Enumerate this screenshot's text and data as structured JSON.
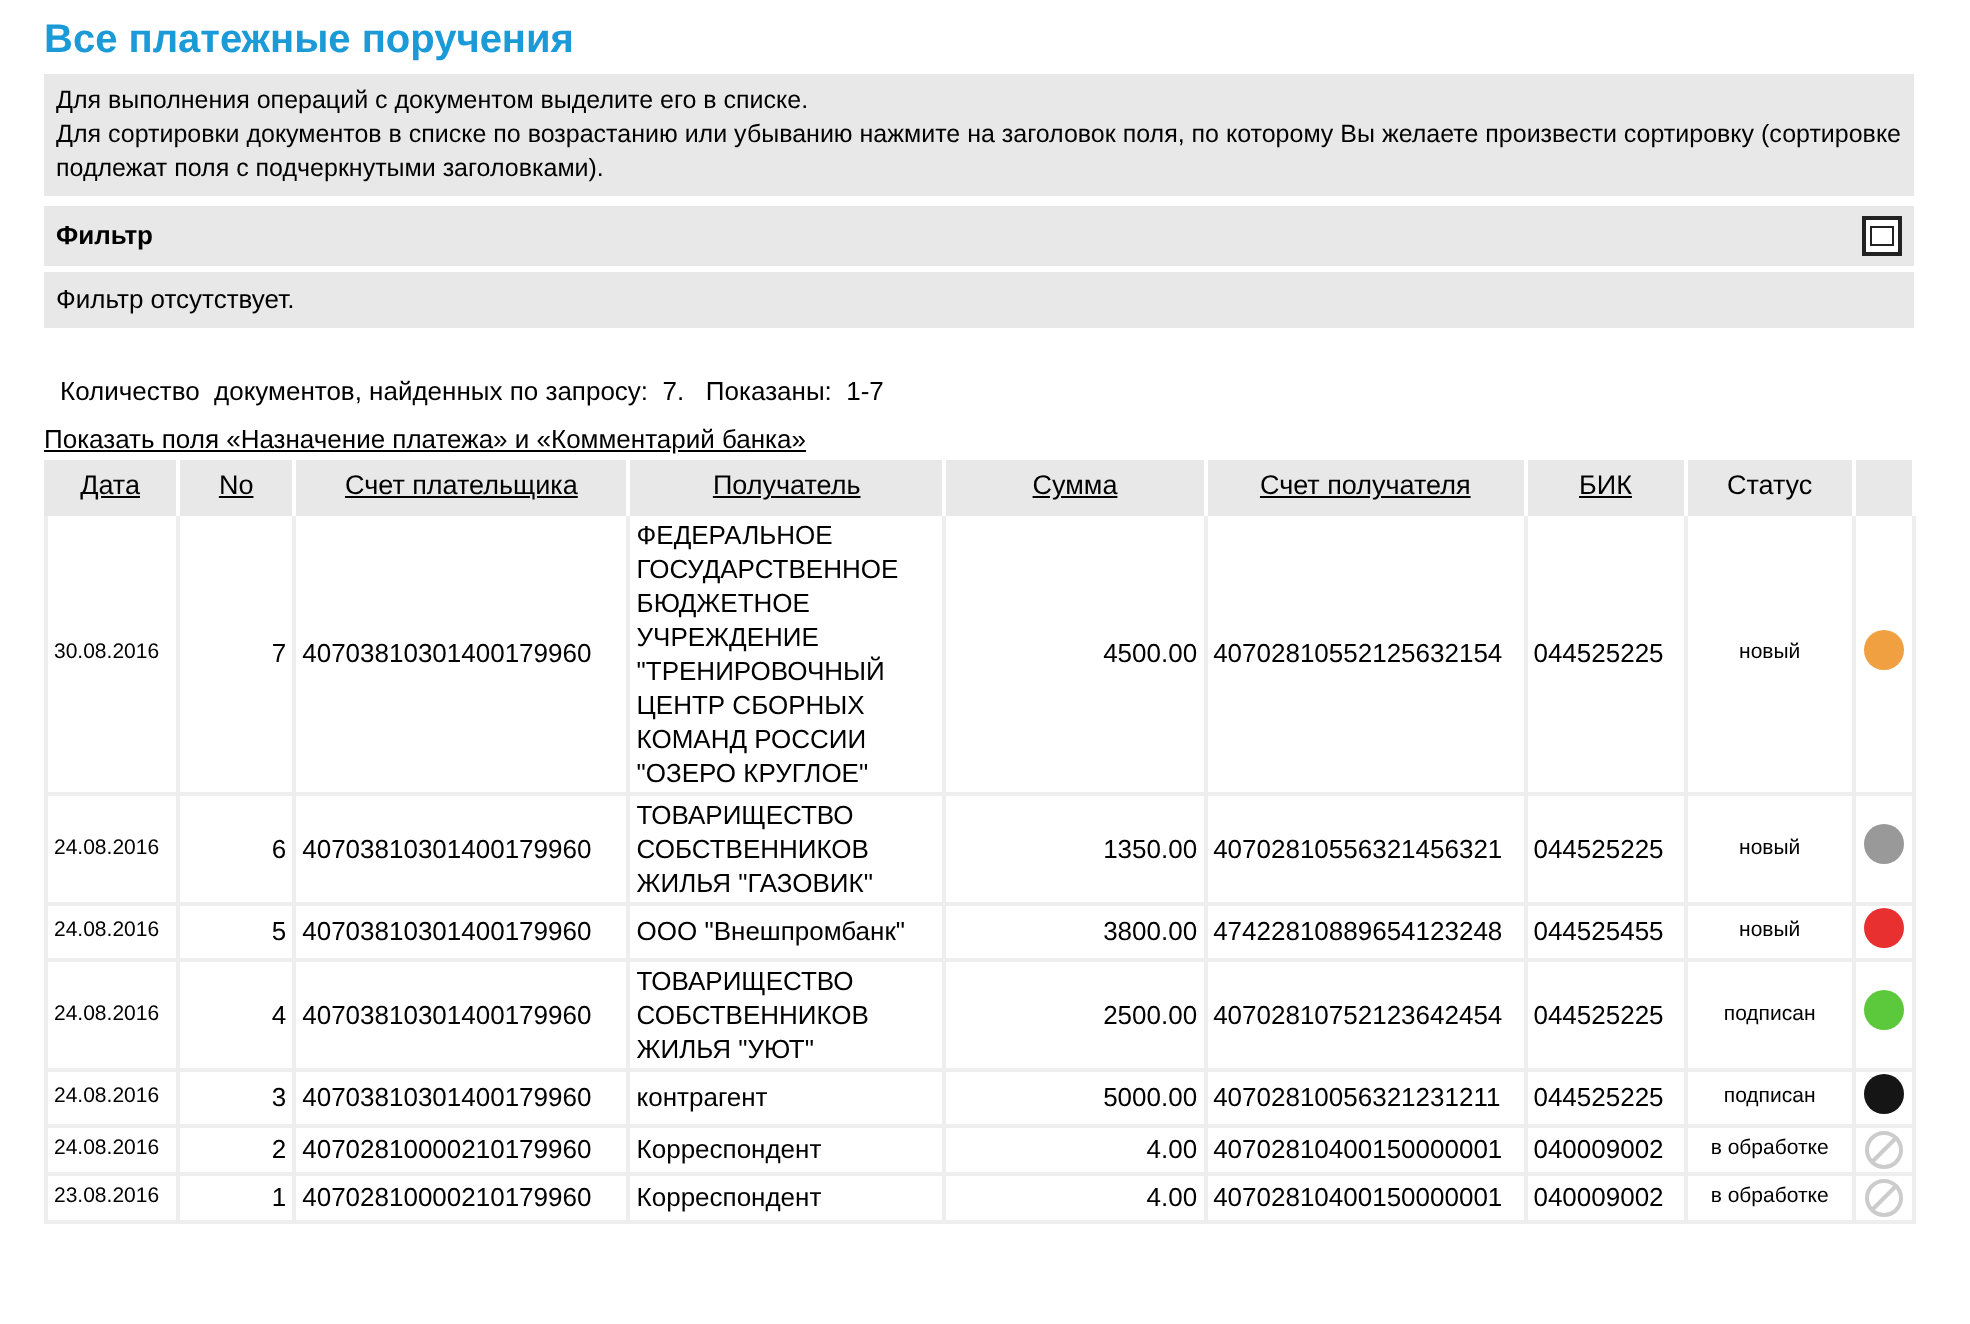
{
  "title": "Все платежные поручения",
  "info_lines": [
    "Для выполнения операций с документом выделите его в списке.",
    "Для сортировки документов в списке по возрастанию или убыванию нажмите на заголовок поля, по которому Вы желаете произвести сортировку (сортировке подлежат поля с подчеркнутыми заголовками)."
  ],
  "filter": {
    "title": "Фильтр",
    "expanded": false,
    "text": "Фильтр отсутствует."
  },
  "summary": "Количество  документов, найденных по запросу:  7.   Показаны:  1-7",
  "show_fields_link": "Показать поля «Назначение платежа» и «Комментарий банка»",
  "table": {
    "columns": [
      {
        "label": "Дата",
        "sortable": true
      },
      {
        "label": "No",
        "sortable": true
      },
      {
        "label": "Счет плательщика",
        "sortable": true
      },
      {
        "label": "Получатель",
        "sortable": true
      },
      {
        "label": "Сумма",
        "sortable": true
      },
      {
        "label": "Счет получателя",
        "sortable": true
      },
      {
        "label": "БИК",
        "sortable": true
      },
      {
        "label": "Статус",
        "sortable": false
      }
    ],
    "rows": [
      {
        "date": "30.08.2016",
        "no": "7",
        "payer_account": "40703810301400179960",
        "recipient": "ФЕДЕРАЛЬНОЕ ГОСУДАРСТВЕННОЕ БЮДЖЕТНОЕ УЧРЕЖДЕНИЕ \"ТРЕНИРОВОЧНЫЙ ЦЕНТР СБОРНЫХ КОМАНД РОССИИ \"ОЗЕРО КРУГЛОЕ\"",
        "amount": "4500.00",
        "recipient_account": "40702810552125632154",
        "bik": "044525225",
        "status": "новый",
        "indicator": {
          "kind": "dot",
          "color": "#f0a040"
        }
      },
      {
        "date": "24.08.2016",
        "no": "6",
        "payer_account": "40703810301400179960",
        "recipient": "ТОВАРИЩЕСТВО СОБСТВЕННИКОВ ЖИЛЬЯ \"ГАЗОВИК\"",
        "amount": "1350.00",
        "recipient_account": "40702810556321456321",
        "bik": "044525225",
        "status": "новый",
        "indicator": {
          "kind": "dot",
          "color": "#999999"
        }
      },
      {
        "date": "24.08.2016",
        "no": "5",
        "payer_account": "40703810301400179960",
        "recipient": "ООО \"Внешпромбанк\"",
        "amount": "3800.00",
        "recipient_account": "47422810889654123248",
        "bik": "044525455",
        "status": "новый",
        "indicator": {
          "kind": "dot",
          "color": "#e83030"
        }
      },
      {
        "date": "24.08.2016",
        "no": "4",
        "payer_account": "40703810301400179960",
        "recipient": "ТОВАРИЩЕСТВО СОБСТВЕННИКОВ ЖИЛЬЯ \"УЮТ\"",
        "amount": "2500.00",
        "recipient_account": "40702810752123642454",
        "bik": "044525225",
        "status": "подписан",
        "indicator": {
          "kind": "dot",
          "color": "#5cc83c"
        }
      },
      {
        "date": "24.08.2016",
        "no": "3",
        "payer_account": "40703810301400179960",
        "recipient": "контрагент",
        "amount": "5000.00",
        "recipient_account": "40702810056321231211",
        "bik": "044525225",
        "status": "подписан",
        "indicator": {
          "kind": "dot",
          "color": "#151515"
        }
      },
      {
        "date": "24.08.2016",
        "no": "2",
        "payer_account": "40702810000210179960",
        "recipient": "Корреспондент",
        "amount": "4.00",
        "recipient_account": "40702810400150000001",
        "bik": "040009002",
        "status": "в обработке",
        "indicator": {
          "kind": "blocked"
        }
      },
      {
        "date": "23.08.2016",
        "no": "1",
        "payer_account": "40702810000210179960",
        "recipient": "Корреспондент",
        "amount": "4.00",
        "recipient_account": "40702810400150000001",
        "bik": "040009002",
        "status": "в обработке",
        "indicator": {
          "kind": "blocked"
        }
      }
    ]
  }
}
